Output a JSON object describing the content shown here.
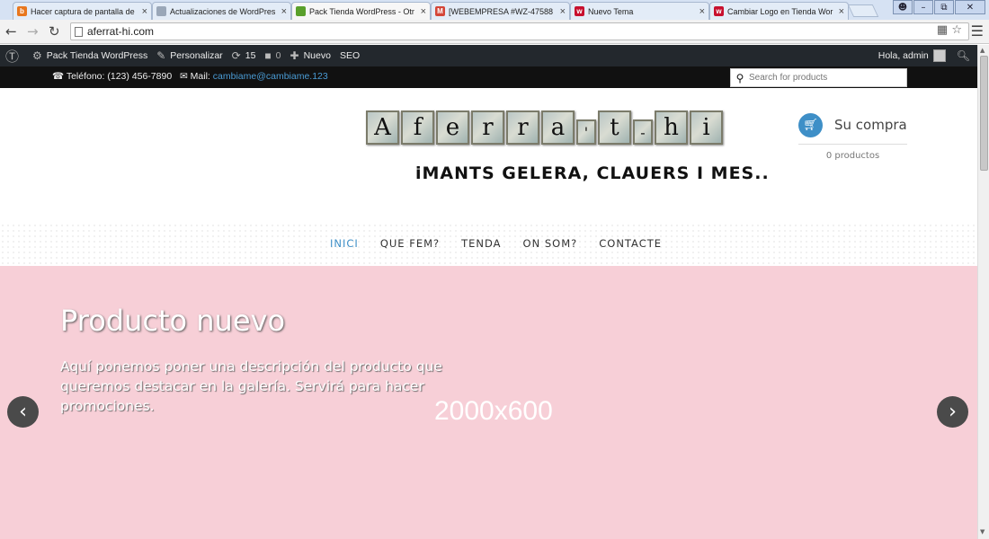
{
  "browser": {
    "tabs": [
      {
        "label": "Hacer captura de pantalla de",
        "favicon": "orange-circle-icon",
        "color": "#e8771e",
        "glyph": "b",
        "active": false
      },
      {
        "label": "Actualizaciones de WordPres",
        "favicon": "page-icon",
        "color": "#9aa7b8",
        "glyph": "",
        "active": false
      },
      {
        "label": "Pack Tienda WordPress - Otr",
        "favicon": "leaf-icon",
        "color": "#5aa02c",
        "glyph": "",
        "active": true
      },
      {
        "label": "[WEBEMPRESA #WZ-47588",
        "favicon": "gmail-icon",
        "color": "#d44638",
        "glyph": "M",
        "active": false
      },
      {
        "label": "Nuevo Tema",
        "favicon": "w-icon",
        "color": "#c8102e",
        "glyph": "w",
        "active": false
      },
      {
        "label": "Cambiar Logo en Tienda Wor",
        "favicon": "w-icon",
        "color": "#c8102e",
        "glyph": "w",
        "active": false
      }
    ],
    "url": "aferrat-hi.com"
  },
  "adminbar": {
    "site": "Pack Tienda WordPress",
    "customize": "Personalizar",
    "updates": "15",
    "comments": "0",
    "new": "Nuevo",
    "seo": "SEO",
    "greeting": "Hola, admin"
  },
  "topbar": {
    "phone": "Teléfono: (123) 456-7890",
    "mail_label": "Mail:",
    "mail": "cambiame@cambiame.123",
    "search_placeholder": "Search for products"
  },
  "logo": {
    "letters": [
      "A",
      "f",
      "e",
      "r",
      "r",
      "a",
      "'",
      "t",
      "-",
      "h",
      "i"
    ],
    "tagline": "iMANTS GELERA, CLAUERS I MES.."
  },
  "cart": {
    "title": "Su compra",
    "count": "0 productos"
  },
  "nav": [
    {
      "label": "INICI",
      "active": true
    },
    {
      "label": "QUE FEM?",
      "active": false
    },
    {
      "label": "TENDA",
      "active": false
    },
    {
      "label": "ON SOM?",
      "active": false
    },
    {
      "label": "CONTACTE",
      "active": false
    }
  ],
  "slider": {
    "title": "Producto nuevo",
    "description": "Aquí ponemos poner una descripción del producto que queremos destacar en la galería. Servirá para hacer promociones.",
    "dimensions": "2000x600",
    "background": "#f7cfd7"
  },
  "colors": {
    "accent": "#3e8fc7",
    "adminbar": "#23282d",
    "topbar": "#111111"
  }
}
